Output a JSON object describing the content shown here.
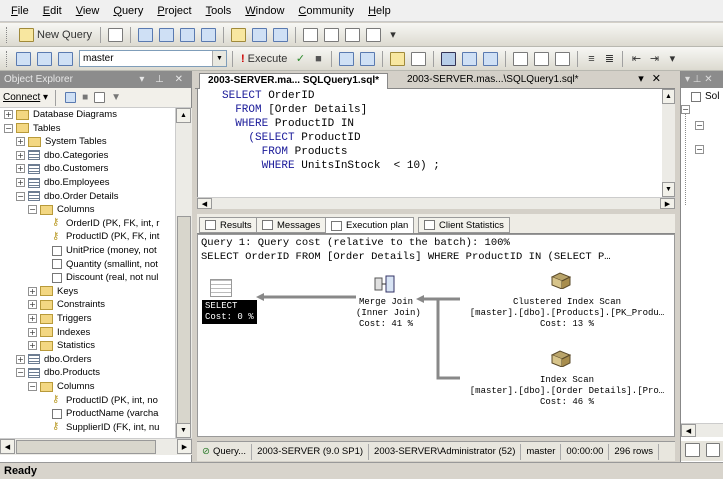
{
  "menu": [
    "File",
    "Edit",
    "View",
    "Query",
    "Project",
    "Tools",
    "Window",
    "Community",
    "Help"
  ],
  "toolbar1": {
    "new_query": "New Query"
  },
  "toolbar2": {
    "database": "master",
    "execute": "Execute"
  },
  "object_explorer": {
    "title": "Object Explorer",
    "connect": "Connect",
    "tree": [
      {
        "label": "Database Diagrams",
        "indent": 0,
        "exp": "+",
        "icon": "folder"
      },
      {
        "label": "Tables",
        "indent": 0,
        "exp": "−",
        "icon": "folder"
      },
      {
        "label": "System Tables",
        "indent": 1,
        "exp": "+",
        "icon": "folder"
      },
      {
        "label": "dbo.Categories",
        "indent": 1,
        "exp": "+",
        "icon": "table"
      },
      {
        "label": "dbo.Customers",
        "indent": 1,
        "exp": "+",
        "icon": "table"
      },
      {
        "label": "dbo.Employees",
        "indent": 1,
        "exp": "+",
        "icon": "table"
      },
      {
        "label": "dbo.Order Details",
        "indent": 1,
        "exp": "−",
        "icon": "table"
      },
      {
        "label": "Columns",
        "indent": 2,
        "exp": "−",
        "icon": "folder"
      },
      {
        "label": "OrderID (PK, FK, int, r",
        "indent": 3,
        "exp": "",
        "icon": "key"
      },
      {
        "label": "ProductID (PK, FK, int",
        "indent": 3,
        "exp": "",
        "icon": "key"
      },
      {
        "label": "UnitPrice (money, not",
        "indent": 3,
        "exp": "",
        "icon": "column"
      },
      {
        "label": "Quantity (smallint, not",
        "indent": 3,
        "exp": "",
        "icon": "column"
      },
      {
        "label": "Discount (real, not nul",
        "indent": 3,
        "exp": "",
        "icon": "column"
      },
      {
        "label": "Keys",
        "indent": 2,
        "exp": "+",
        "icon": "folder"
      },
      {
        "label": "Constraints",
        "indent": 2,
        "exp": "+",
        "icon": "folder"
      },
      {
        "label": "Triggers",
        "indent": 2,
        "exp": "+",
        "icon": "folder"
      },
      {
        "label": "Indexes",
        "indent": 2,
        "exp": "+",
        "icon": "folder"
      },
      {
        "label": "Statistics",
        "indent": 2,
        "exp": "+",
        "icon": "folder"
      },
      {
        "label": "dbo.Orders",
        "indent": 1,
        "exp": "+",
        "icon": "table"
      },
      {
        "label": "dbo.Products",
        "indent": 1,
        "exp": "−",
        "icon": "table"
      },
      {
        "label": "Columns",
        "indent": 2,
        "exp": "−",
        "icon": "folder"
      },
      {
        "label": "ProductID (PK, int, no",
        "indent": 3,
        "exp": "",
        "icon": "key"
      },
      {
        "label": "ProductName (varcha",
        "indent": 3,
        "exp": "",
        "icon": "column"
      },
      {
        "label": "SupplierID (FK, int, nu",
        "indent": 3,
        "exp": "",
        "icon": "key"
      }
    ]
  },
  "editor": {
    "tab_active": "2003-SERVER.ma... SQLQuery1.sql*",
    "tab_inactive": "2003-SERVER.mas...\\SQLQuery1.sql*",
    "code": [
      [
        "SELECT",
        " OrderID"
      ],
      [
        "  FROM",
        " [Order Details]"
      ],
      [
        "  WHERE",
        " ProductID IN"
      ],
      [
        "    (SELECT",
        " ProductID"
      ],
      [
        "      FROM",
        " Products"
      ],
      [
        "      WHERE",
        " UnitsInStock  < 10) ;"
      ]
    ]
  },
  "results_tabs": [
    "Results",
    "Messages",
    "Execution plan",
    "Client Statistics"
  ],
  "plan": {
    "header1": "Query 1: Query cost (relative to the batch): 100%",
    "header2": "SELECT OrderID FROM [Order Details] WHERE ProductID IN (SELECT P…",
    "select_label": "SELECT",
    "select_cost": "Cost: 0 %",
    "merge_join": "Merge Join\n(Inner Join)\nCost: 41 %",
    "clustered_scan": "Clustered Index Scan\n[master].[dbo].[Products].[PK_Produ…\nCost: 13 %",
    "index_scan": "Index Scan\n[master].[dbo].[Order Details].[Pro…\nCost: 46 %"
  },
  "query_status": {
    "state": "Query...",
    "server": "2003-SERVER (9.0 SP1)",
    "user": "2003-SERVER\\Administrator (52)",
    "db": "master",
    "time": "00:00:00",
    "rows": "296 rows"
  },
  "solution_explorer": {
    "title": "Sol"
  },
  "status_bar": "Ready"
}
